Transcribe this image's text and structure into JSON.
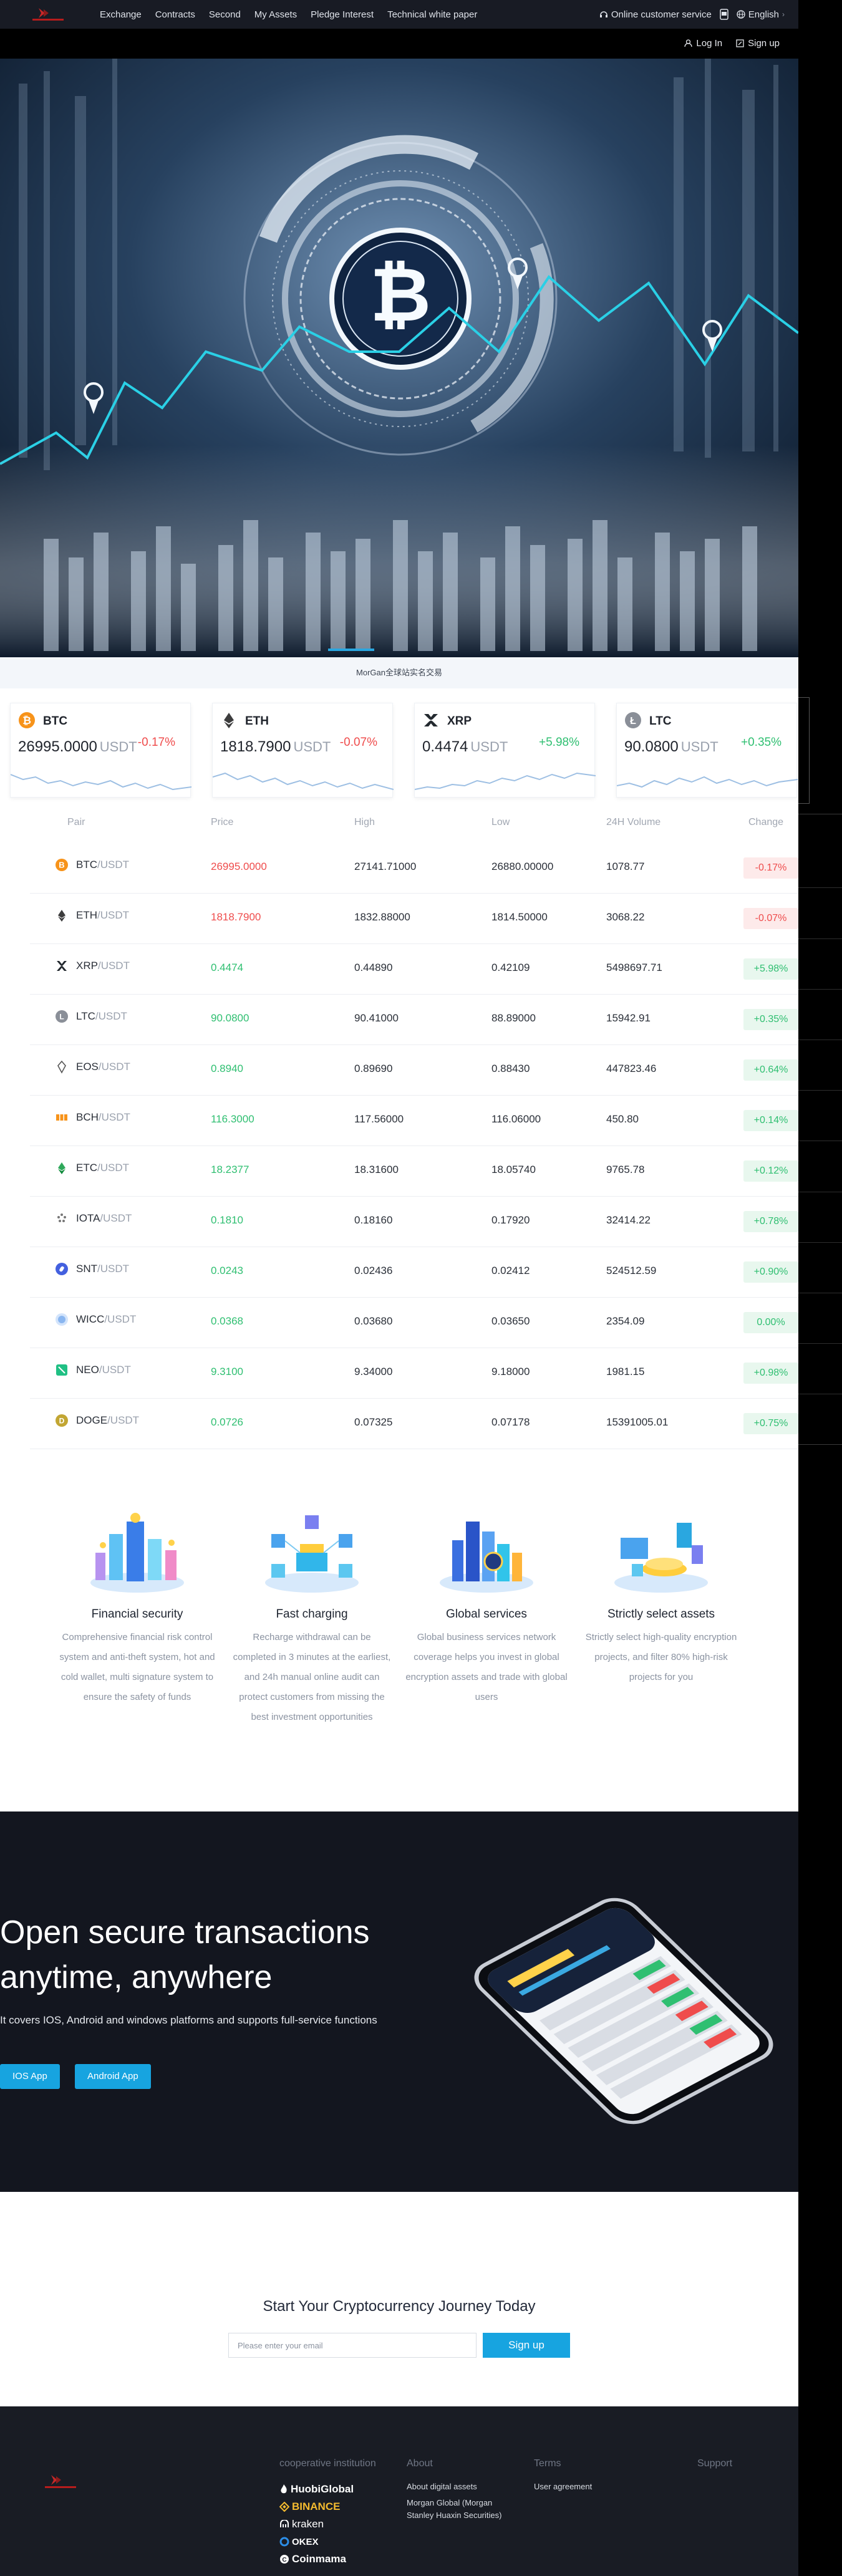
{
  "header": {
    "nav": [
      "Exchange",
      "Contracts",
      "Second",
      "My Assets",
      "Pledge Interest",
      "Technical white paper"
    ],
    "service": "Online customer service",
    "language": "English",
    "login": "Log In",
    "signup": "Sign up"
  },
  "notice": "MorGan全球站实名交易",
  "cards": [
    {
      "symbol": "BTC",
      "price": "26995.0000",
      "unit": "USDT",
      "change": "-0.17%",
      "dir": "down"
    },
    {
      "symbol": "ETH",
      "price": "1818.7900",
      "unit": "USDT",
      "change": "-0.07%",
      "dir": "down"
    },
    {
      "symbol": "XRP",
      "price": "0.4474",
      "unit": "USDT",
      "change": "+5.98%",
      "dir": "up"
    },
    {
      "symbol": "LTC",
      "price": "90.0800",
      "unit": "USDT",
      "change": "+0.35%",
      "dir": "up"
    }
  ],
  "table": {
    "headers": [
      "Pair",
      "Price",
      "High",
      "Low",
      "24H Volume",
      "Change"
    ],
    "quote": "/USDT",
    "rows": [
      {
        "base": "BTC",
        "icon": "btc",
        "price": "26995.0000",
        "high": "27141.71000",
        "low": "26880.00000",
        "volume": "1078.77",
        "change": "-0.17%",
        "dir": "down"
      },
      {
        "base": "ETH",
        "icon": "eth",
        "price": "1818.7900",
        "high": "1832.88000",
        "low": "1814.50000",
        "volume": "3068.22",
        "change": "-0.07%",
        "dir": "down"
      },
      {
        "base": "XRP",
        "icon": "xrp",
        "price": "0.4474",
        "high": "0.44890",
        "low": "0.42109",
        "volume": "5498697.71",
        "change": "+5.98%",
        "dir": "up"
      },
      {
        "base": "LTC",
        "icon": "ltc",
        "price": "90.0800",
        "high": "90.41000",
        "low": "88.89000",
        "volume": "15942.91",
        "change": "+0.35%",
        "dir": "up"
      },
      {
        "base": "EOS",
        "icon": "eos",
        "price": "0.8940",
        "high": "0.89690",
        "low": "0.88430",
        "volume": "447823.46",
        "change": "+0.64%",
        "dir": "up"
      },
      {
        "base": "BCH",
        "icon": "bch",
        "price": "116.3000",
        "high": "117.56000",
        "low": "116.06000",
        "volume": "450.80",
        "change": "+0.14%",
        "dir": "up"
      },
      {
        "base": "ETC",
        "icon": "etc",
        "price": "18.2377",
        "high": "18.31600",
        "low": "18.05740",
        "volume": "9765.78",
        "change": "+0.12%",
        "dir": "up"
      },
      {
        "base": "IOTA",
        "icon": "iota",
        "price": "0.1810",
        "high": "0.18160",
        "low": "0.17920",
        "volume": "32414.22",
        "change": "+0.78%",
        "dir": "up"
      },
      {
        "base": "SNT",
        "icon": "snt",
        "price": "0.0243",
        "high": "0.02436",
        "low": "0.02412",
        "volume": "524512.59",
        "change": "+0.90%",
        "dir": "up"
      },
      {
        "base": "WICC",
        "icon": "wicc",
        "price": "0.0368",
        "high": "0.03680",
        "low": "0.03650",
        "volume": "2354.09",
        "change": "0.00%",
        "dir": "up"
      },
      {
        "base": "NEO",
        "icon": "neo",
        "price": "9.3100",
        "high": "9.34000",
        "low": "9.18000",
        "volume": "1981.15",
        "change": "+0.98%",
        "dir": "up"
      },
      {
        "base": "DOGE",
        "icon": "doge",
        "price": "0.0726",
        "high": "0.07325",
        "low": "0.07178",
        "volume": "15391005.01",
        "change": "+0.75%",
        "dir": "up"
      }
    ]
  },
  "features": [
    {
      "title": "Financial security",
      "desc": "Comprehensive financial risk control system and anti-theft system, hot and cold wallet, multi signature system to ensure the safety of funds"
    },
    {
      "title": "Fast charging",
      "desc": "Recharge withdrawal can be completed in 3 minutes at the earliest, and 24h manual online audit can protect customers from missing the best investment opportunities"
    },
    {
      "title": "Global services",
      "desc": "Global business services network coverage helps you invest in global encryption assets and trade with global users"
    },
    {
      "title": "Strictly select assets",
      "desc": "Strictly select high-quality encryption projects, and filter 80% high-risk projects for you"
    }
  ],
  "app": {
    "title_line1": "Open secure transactions",
    "title_line2": "anytime, anywhere",
    "subtitle": "It covers IOS, Android and windows platforms and supports full-service functions",
    "ios": "IOS App",
    "android": "Android App"
  },
  "journey": {
    "title": "Start Your Cryptocurrency Journey Today",
    "placeholder": "Please enter your email",
    "button": "Sign up"
  },
  "footer": {
    "coop_title": "cooperative institution",
    "partners": [
      "HuobiGlobal",
      "BINANCE",
      "kraken",
      "OKEX",
      "Coinmama"
    ],
    "about_title": "About",
    "about_links": [
      "About digital assets",
      "Morgan Global (Morgan Stanley Huaxin Securities)"
    ],
    "terms_title": "Terms",
    "terms_links": [
      "User agreement"
    ],
    "support_title": "Support"
  },
  "colors": {
    "up": "#2fbf71",
    "down": "#ef4c4c",
    "accent": "#17a4e0",
    "header_bg": "#181b24",
    "footer_bg": "#191c24"
  }
}
